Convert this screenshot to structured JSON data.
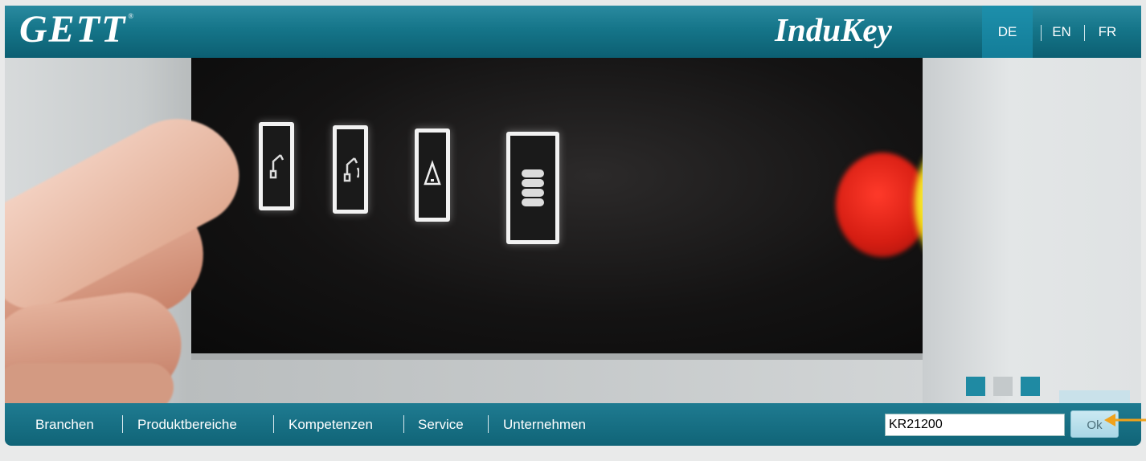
{
  "header": {
    "logo_text": "GETT",
    "logo_mark": "®",
    "brand_text": "InduKey",
    "languages": [
      {
        "code": "DE",
        "active": true
      },
      {
        "code": "EN",
        "active": false
      },
      {
        "code": "FR",
        "active": false
      }
    ]
  },
  "hero": {
    "slider_dots": [
      {
        "color": "#1f8aa3",
        "active": true
      },
      {
        "color": "#c4c9cb",
        "active": false
      },
      {
        "color": "#1f8aa3",
        "active": false
      }
    ]
  },
  "nav": {
    "items": [
      "Branchen",
      "Produktbereiche",
      "Kompetenzen",
      "Service",
      "Unternehmen"
    ]
  },
  "search": {
    "value": "KR21200",
    "button_label": "Ok"
  },
  "colors": {
    "header_teal": "#157589",
    "annotation_arrow": "#f0a21b"
  }
}
